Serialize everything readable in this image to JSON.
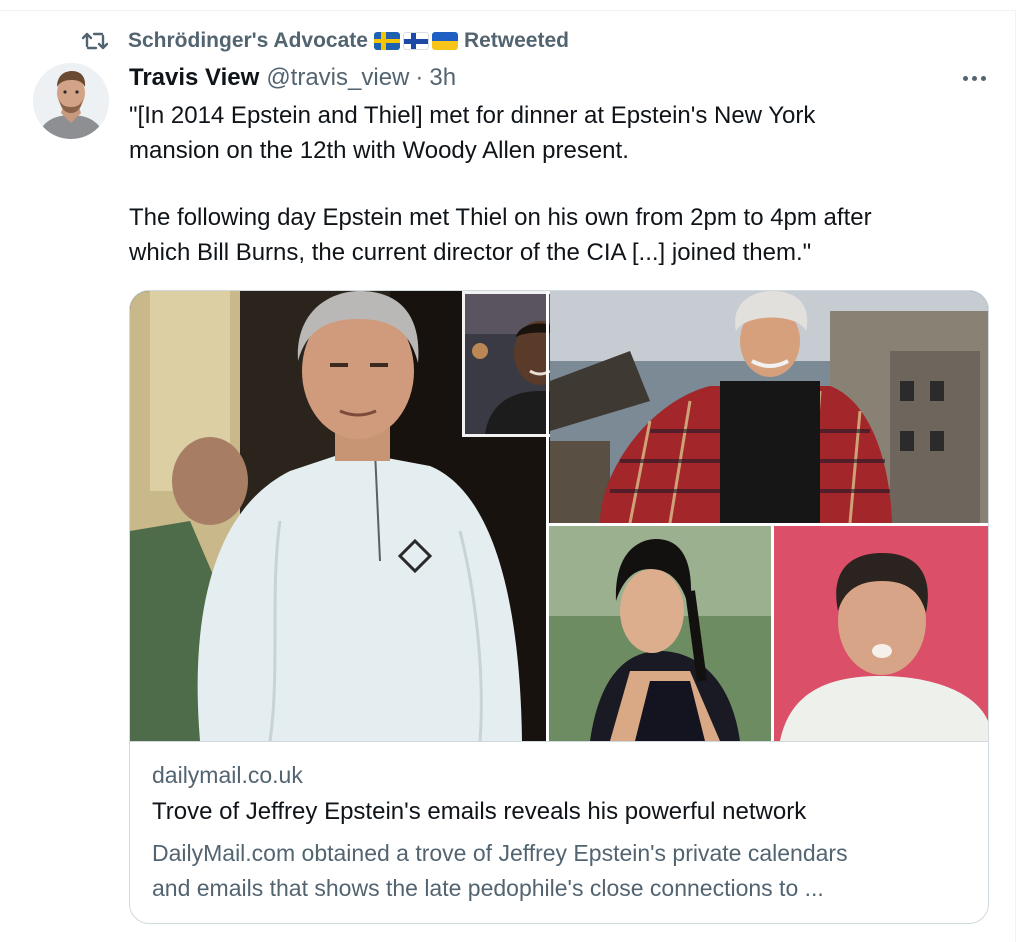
{
  "retweet_banner": {
    "icon": "retweet-icon",
    "retweeter_name": "Schrödinger's Advocate",
    "flags": [
      "flag-sweden",
      "flag-finland",
      "flag-ukraine"
    ],
    "label": "Retweeted"
  },
  "tweet": {
    "author_name": "Travis View",
    "author_handle": "@travis_view",
    "separator": "·",
    "time": "3h",
    "text_lines": [
      "\"[In 2014 Epstein and Thiel] met for dinner at Epstein's New York",
      "mansion on the 12th with Woody Allen present.",
      "The following day Epstein met Thiel on his own from 2pm to 4pm after",
      "which Bill Burns, the current director of the CIA [...] joined them.\""
    ]
  },
  "link_card": {
    "domain": "dailymail.co.uk",
    "title": "Trove of Jeffrey Epstein's emails reveals his powerful network",
    "description_lines": [
      "DailyMail.com obtained a trove of Jeffrey Epstein's private calendars",
      "and emails that shows the late pedophile's close connections to ..."
    ]
  },
  "colors": {
    "text_primary": "#0f1419",
    "text_secondary": "#536471",
    "border": "#cfd9de"
  }
}
